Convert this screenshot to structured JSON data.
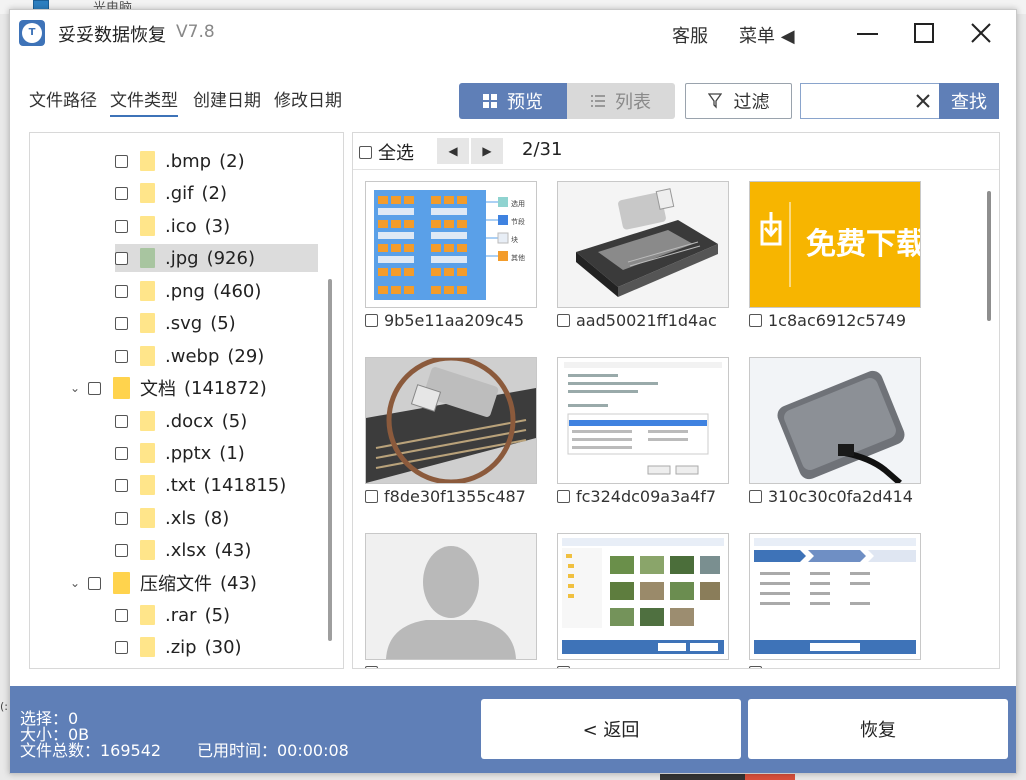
{
  "background": {
    "window_fragment": "…光电脑",
    "side_text": "(:"
  },
  "window": {
    "logo": "T",
    "title": "妥妥数据恢复",
    "version": "V7.8",
    "service_label": "客服",
    "menu_label": "菜单 ◀"
  },
  "filter_tabs": [
    "文件路径",
    "文件类型",
    "创建日期",
    "修改日期"
  ],
  "active_tab": "文件类型",
  "toolbar": {
    "preview_label": "预览",
    "list_label": "列表",
    "filter_label": "过滤",
    "search_value": "",
    "search_placeholder": "",
    "search_button": "查找"
  },
  "tree": [
    {
      "name": ".bmp",
      "count": "(2)"
    },
    {
      "name": ".gif",
      "count": "(2)"
    },
    {
      "name": ".ico",
      "count": "(3)"
    },
    {
      "name": ".jpg",
      "count": "(926)"
    },
    {
      "name": ".png",
      "count": "(460)"
    },
    {
      "name": ".svg",
      "count": "(5)"
    },
    {
      "name": ".webp",
      "count": "(29)"
    },
    {
      "name": "文档",
      "count": "(141872)"
    },
    {
      "name": ".docx",
      "count": "(5)"
    },
    {
      "name": ".pptx",
      "count": "(1)"
    },
    {
      "name": ".txt",
      "count": "(141815)"
    },
    {
      "name": ".xls",
      "count": "(8)"
    },
    {
      "name": ".xlsx",
      "count": "(43)"
    },
    {
      "name": "压缩文件",
      "count": "(43)"
    },
    {
      "name": ".rar",
      "count": "(5)"
    },
    {
      "name": ".zip",
      "count": "(30)"
    }
  ],
  "selected_tree_item": ".jpg",
  "preview": {
    "select_all_label": "全选",
    "page_info": "2/31",
    "files": [
      "9b5e11aa209c45",
      "aad50021ff1d4ac",
      "1c8ac6912c5749",
      "f8de30f1355c487",
      "fc324dc09a3a4f7",
      "310c30c0fa2d414"
    ],
    "diagram_labels": [
      "选用",
      "节段",
      "块",
      "其他"
    ],
    "banner_text": "免费下载"
  },
  "footer": {
    "selected": "选择：0",
    "size": "大小：0B",
    "total": "文件总数：169542",
    "elapsed": "已用时间：00:00:08",
    "back_label": "< 返回",
    "recover_label": "恢复"
  },
  "colors": {
    "accent": "#5f7fb7",
    "folder": "#ffe58a",
    "banner": "#f7b500",
    "selected_row": "#dcdcdc"
  }
}
